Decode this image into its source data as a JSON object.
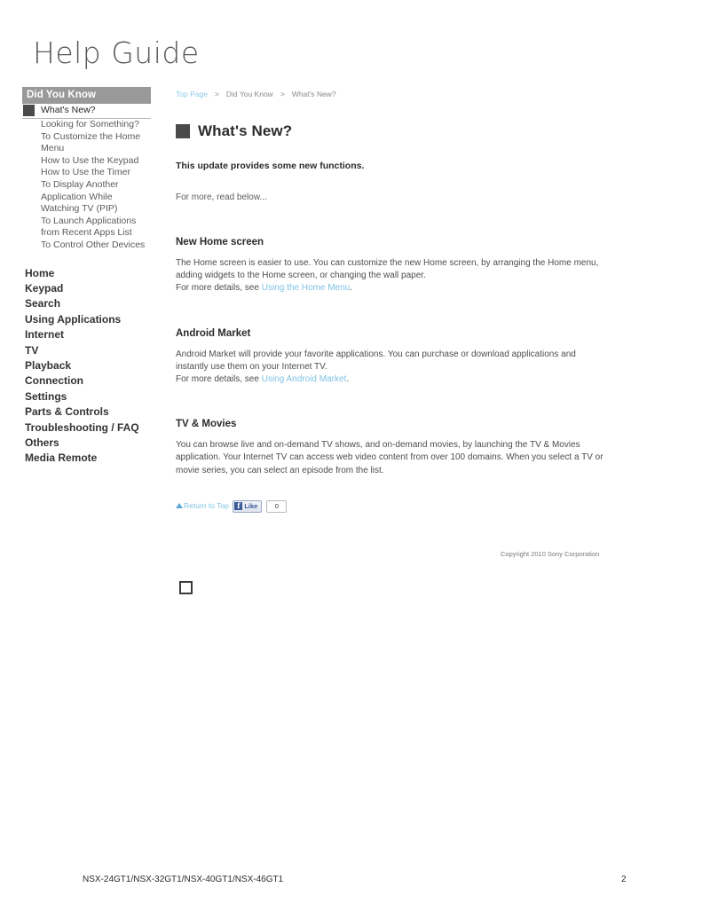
{
  "header": {
    "title": "Help Guide"
  },
  "sidebar": {
    "section_header": "Did You Know",
    "sub_items": [
      {
        "label": "What's New?",
        "active": true
      },
      {
        "label": "Looking for Something?",
        "active": false
      },
      {
        "label": "To Customize the Home Menu",
        "active": false
      },
      {
        "label": "How to Use the Keypad",
        "active": false
      },
      {
        "label": "How to Use the Timer",
        "active": false
      },
      {
        "label": "To Display Another Application While Watching TV (PIP)",
        "active": false
      },
      {
        "label": "To Launch Applications from Recent Apps List",
        "active": false
      },
      {
        "label": "To Control Other Devices",
        "active": false
      }
    ],
    "main_items": [
      {
        "label": "Home"
      },
      {
        "label": "Keypad"
      },
      {
        "label": "Search"
      },
      {
        "label": "Using Applications"
      },
      {
        "label": "Internet"
      },
      {
        "label": "TV"
      },
      {
        "label": "Playback"
      },
      {
        "label": "Connection"
      },
      {
        "label": "Settings"
      },
      {
        "label": "Parts & Controls"
      },
      {
        "label": "Troubleshooting / FAQ"
      },
      {
        "label": "Others"
      },
      {
        "label": "Media Remote"
      }
    ]
  },
  "breadcrumb": {
    "items": [
      {
        "label": "Top Page",
        "is_link": true
      },
      {
        "label": "Did You Know",
        "is_link": false
      },
      {
        "label": "What's New?",
        "is_link": false
      }
    ],
    "separator": ">"
  },
  "main": {
    "heading": "What's New?",
    "lead": "This update provides some new functions.",
    "read_more": "For more, read below...",
    "sections": [
      {
        "title": "New Home screen",
        "body_pre": "The Home screen is easier to use. You can customize the new Home screen, by arranging the Home menu, adding widgets to the Home screen, or changing the wall paper.",
        "body_line2_pre": "For more details, see ",
        "link_text": "Using the Home Menu",
        "body_post": "."
      },
      {
        "title": "Android Market",
        "body_pre": "Android Market will provide your favorite applications. You can purchase or download applications and instantly use them on your Internet TV.",
        "body_line2_pre": "For more details, see ",
        "link_text": "Using Android Market",
        "body_post": "."
      },
      {
        "title": "TV & Movies",
        "body_pre": "You can browse live and on-demand TV shows, and on-demand movies, by launching the TV & Movies application. Your Internet TV can access web video content from over 100 domains. When you select a TV or movie series, you can select an episode from the list.",
        "body_line2_pre": "",
        "link_text": "",
        "body_post": ""
      }
    ],
    "return_to_top": "Return to Top"
  },
  "social": {
    "fb_icon_glyph": "f",
    "fb_like_label": "Like",
    "fb_like_count": "0"
  },
  "footer": {
    "copyright": "Copyright 2010 Sony Corporation",
    "models": "NSX-24GT1/NSX-32GT1/NSX-40GT1/NSX-46GT1",
    "page_number": "2"
  },
  "colors": {
    "link_blue": "#7ec3e4",
    "sidebar_header_gray": "#999999",
    "square_marker": "#4a4a4a"
  }
}
